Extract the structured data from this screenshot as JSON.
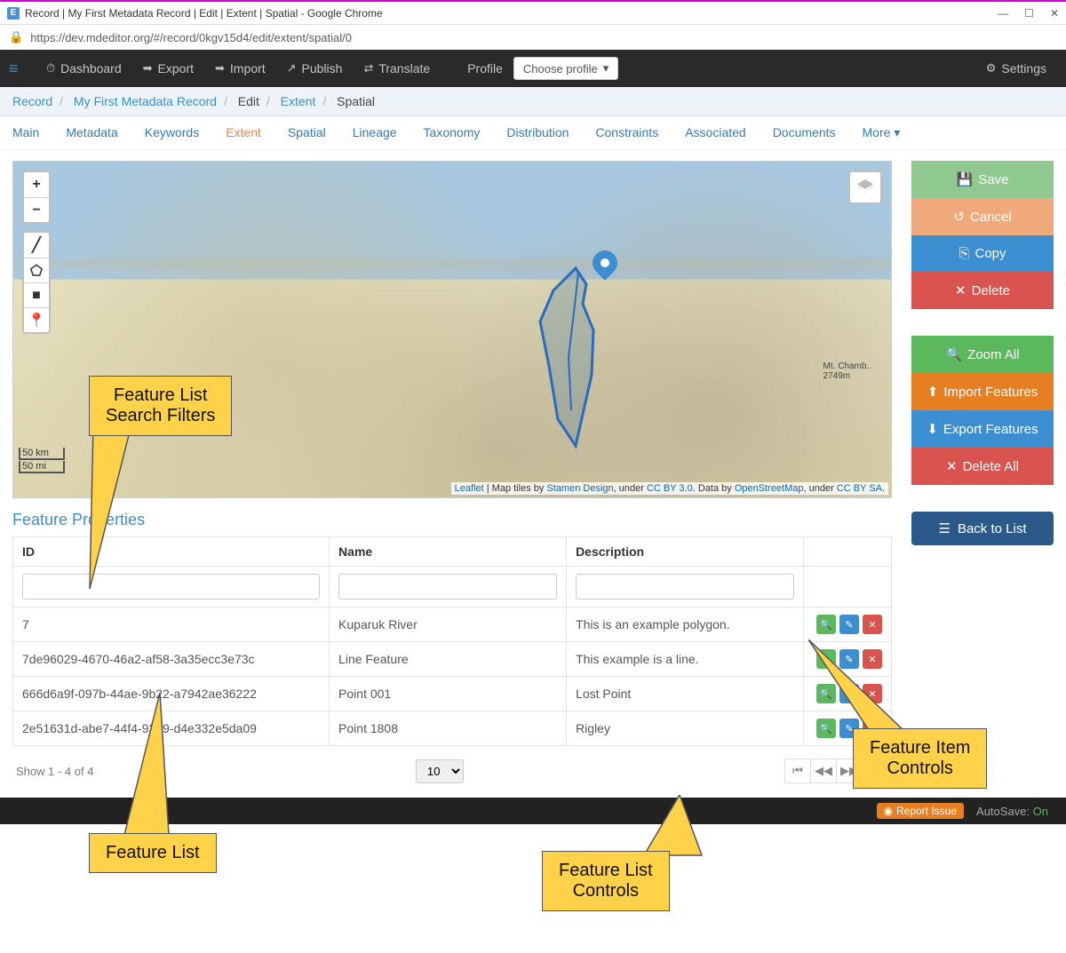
{
  "window": {
    "title": "Record | My First Metadata Record | Edit | Extent | Spatial - Google Chrome",
    "url": "https://dev.mdeditor.org/#/record/0kgv15d4/edit/extent/spatial/0"
  },
  "topnav": {
    "dashboard": "Dashboard",
    "export": "Export",
    "import": "Import",
    "publish": "Publish",
    "translate": "Translate",
    "profile_label": "Profile",
    "profile_btn": "Choose profile",
    "settings": "Settings"
  },
  "breadcrumb": {
    "record": "Record",
    "my_record": "My First Metadata Record",
    "edit": "Edit",
    "extent": "Extent",
    "spatial": "Spatial"
  },
  "subtabs": {
    "main": "Main",
    "metadata": "Metadata",
    "keywords": "Keywords",
    "extent": "Extent",
    "spatial": "Spatial",
    "lineage": "Lineage",
    "taxonomy": "Taxonomy",
    "distribution": "Distribution",
    "constraints": "Constraints",
    "associated": "Associated",
    "documents": "Documents",
    "more": "More"
  },
  "map": {
    "scale_km": "50 km",
    "scale_mi": "50 mi",
    "attr_leaflet": "Leaflet",
    "attr_sep1": " | Map tiles by ",
    "attr_stamen": "Stamen Design",
    "attr_sep2": ", under ",
    "attr_cc": "CC BY 3.0",
    "attr_sep3": ". Data by ",
    "attr_osm": "OpenStreetMap",
    "attr_sep4": ", under ",
    "attr_ccsa": "CC BY SA",
    "attr_dot": ".",
    "label_chamb": "Mt. Chamb..",
    "label_ch_elev": "2749m"
  },
  "section": {
    "feature_properties": "Feature Properties"
  },
  "table": {
    "headers": {
      "id": "ID",
      "name": "Name",
      "desc": "Description"
    },
    "rows": [
      {
        "id": "7",
        "name": "Kuparuk River",
        "desc": "This is an example polygon."
      },
      {
        "id": "7de96029-4670-46a2-af58-3a35ecc3e73c",
        "name": "Line Feature",
        "desc": "This example is a line."
      },
      {
        "id": "666d6a9f-097b-44ae-9b22-a7942ae36222",
        "name": "Point 001",
        "desc": "Lost Point"
      },
      {
        "id": "2e51631d-abe7-44f4-93d9-d4e332e5da09",
        "name": "Point 1808",
        "desc": "Rigley"
      }
    ]
  },
  "pager": {
    "show_text": "Show 1 - 4 of 4",
    "page_size": "10"
  },
  "actions": {
    "save": "Save",
    "cancel": "Cancel",
    "copy": "Copy",
    "delete": "Delete",
    "zoom_all": "Zoom All",
    "import_features": "Import Features",
    "export_features": "Export Features",
    "delete_all": "Delete All",
    "back_to_list": "Back to List"
  },
  "footer": {
    "report_issue": "Report Issue",
    "autosave_label": "AutoSave:",
    "autosave_state": "On"
  },
  "callouts": {
    "filters": "Feature List\nSearch Filters",
    "list": "Feature List",
    "controls": "Feature List\nControls",
    "item_controls": "Feature Item\nControls"
  }
}
